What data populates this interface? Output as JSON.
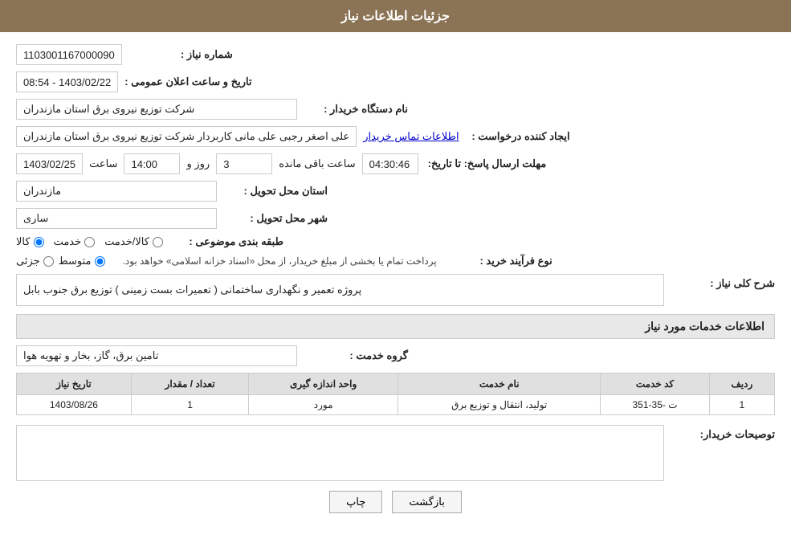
{
  "header": {
    "title": "جزئیات اطلاعات نیاز"
  },
  "fields": {
    "need_number_label": "شماره نیاز :",
    "need_number_value": "1103001167000090",
    "announce_date_label": "تاریخ و ساعت اعلان عمومی :",
    "announce_date_value": "1403/02/22 - 08:54",
    "buyer_label": "نام دستگاه خریدار :",
    "buyer_value": "شرکت توزیع نیروی برق استان مازندران",
    "creator_label": "ایجاد کننده درخواست :",
    "creator_value": "علی اصغر رجبی علی مانی کاربردار شرکت توزیع نیروی برق استان مازندران",
    "creator_link": "اطلاعات تماس خریدار",
    "deadline_label": "مهلت ارسال پاسخ: تا تاریخ:",
    "deadline_date": "1403/02/25",
    "deadline_time_label": "ساعت",
    "deadline_time": "14:00",
    "deadline_day_label": "روز و",
    "deadline_days": "3",
    "deadline_remaining_label": "ساعت باقی مانده",
    "deadline_remaining": "04:30:46",
    "province_label": "استان محل تحویل :",
    "province_value": "مازندران",
    "city_label": "شهر محل تحویل :",
    "city_value": "ساری",
    "category_label": "طبقه بندی موضوعی :",
    "category_options": [
      "کالا",
      "خدمت",
      "کالا/خدمت"
    ],
    "category_selected": "کالا",
    "process_label": "نوع فرآیند خرید :",
    "process_options": [
      "جزئی",
      "متوسط"
    ],
    "process_selected": "متوسط",
    "process_note": "پرداخت تمام یا بخشی از مبلغ خریدار، از محل «اسناد خزانه اسلامی» خواهد بود.",
    "need_desc_label": "شرح کلی نیاز :",
    "need_desc_value": "پروژه تعمیر و نگهداری ساختمانی ( تعمیرات بست زمینی ) توزیع برق جنوب بابل",
    "service_section_title": "اطلاعات خدمات مورد نیاز",
    "service_group_label": "گروه خدمت :",
    "service_group_value": "تامین برق، گاز، بخار و تهویه هوا",
    "table": {
      "headers": [
        "ردیف",
        "کد خدمت",
        "نام خدمت",
        "واحد اندازه گیری",
        "تعداد / مقدار",
        "تاریخ نیاز"
      ],
      "rows": [
        {
          "row": "1",
          "code": "ت -35-351",
          "name": "تولید، انتقال و توزیع برق",
          "unit": "مورد",
          "quantity": "1",
          "date": "1403/08/26"
        }
      ]
    },
    "buyer_notes_label": "توصیحات خریدار:",
    "buyer_notes_value": ""
  },
  "buttons": {
    "print": "چاپ",
    "back": "بازگشت"
  }
}
